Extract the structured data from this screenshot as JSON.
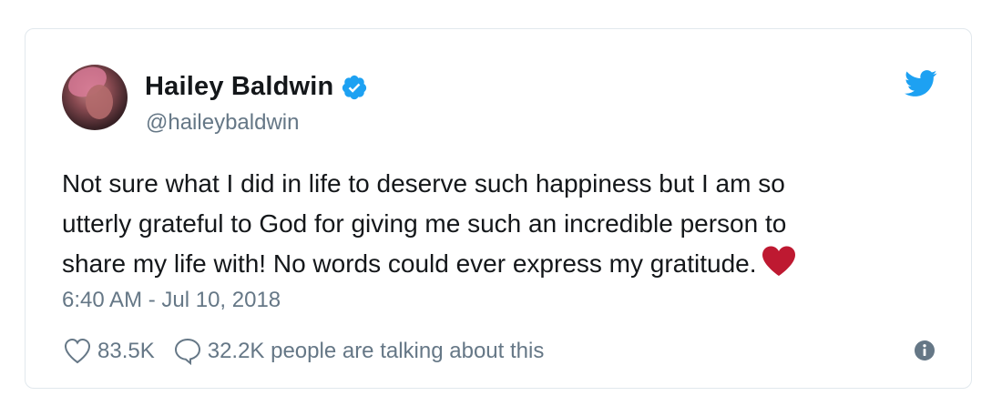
{
  "author": {
    "name": "Hailey Baldwin",
    "handle": "@haileybaldwin",
    "verified": true
  },
  "tweet": {
    "lines": [
      "Not sure what I did in life to deserve such happiness but I am so",
      "utterly grateful to God for giving me such an incredible person to",
      "share my life with! No words could ever express my gratitude."
    ],
    "emoji": "red-heart"
  },
  "timestamp": "6:40 AM - Jul 10, 2018",
  "stats": {
    "likes": "83.5K",
    "replies_text": "32.2K people are talking about this"
  },
  "icons": {
    "brand": "twitter-bird-icon",
    "verified": "verified-badge-icon",
    "like": "heart-outline-icon",
    "reply": "speech-bubble-icon",
    "info": "info-icon"
  },
  "colors": {
    "twitter_blue": "#1da1f2",
    "secondary_text": "#657786",
    "heart_red": "#be1931",
    "border": "#e1e8ed"
  }
}
